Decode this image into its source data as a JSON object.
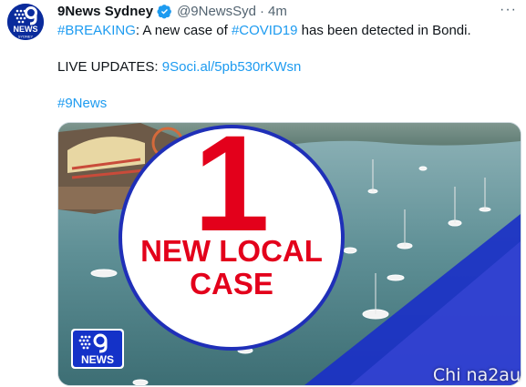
{
  "tweet": {
    "author_name": "9News Sydney",
    "author_handle": "@9NewsSyd",
    "separator": "·",
    "timestamp": "4m",
    "more_label": "···",
    "line1": {
      "hashtag_breaking": "#BREAKING",
      "text_a": ": A new case of ",
      "hashtag_covid": "#COVID19",
      "text_b": " has been detected in Bondi."
    },
    "line2": {
      "label": "LIVE UPDATES: ",
      "link": "9Soci.al/5pb530rKWsn"
    },
    "hashtag_9news": "#9News"
  },
  "avatar": {
    "logo_text": "NEWS",
    "sub_text": "SYDNEY"
  },
  "media": {
    "headline_number": "1",
    "headline_line1": "NEW LOCAL",
    "headline_line2": "CASE",
    "logo_text": "NEWS"
  },
  "watermark": "Chi na2au",
  "colors": {
    "accent": "#1d9bf0",
    "brand_blue": "#0a2b9c",
    "alert_red": "#e3001b"
  }
}
